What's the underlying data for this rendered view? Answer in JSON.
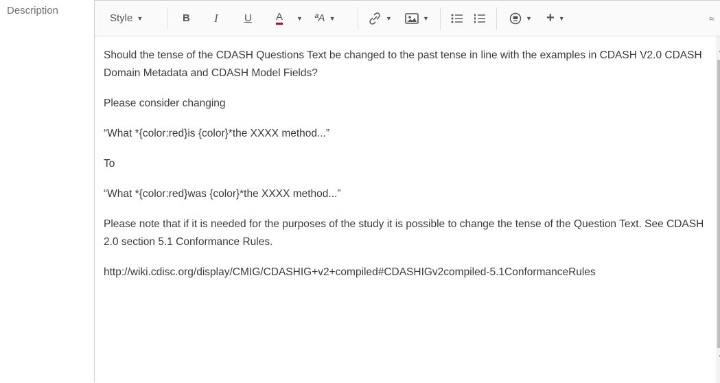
{
  "field": {
    "label": "Description"
  },
  "toolbar": {
    "style_label": "Style",
    "bold": "B",
    "italic": "I",
    "underline": "U",
    "text_color": "A",
    "more_formatting": "ªA",
    "link_icon": "link-icon",
    "image_icon": "image-icon",
    "bullet_list_icon": "bullet-list-icon",
    "numbered_list_icon": "numbered-list-icon",
    "emoticon_icon": "emoticon-icon",
    "insert_label": "+",
    "collapse_icon": "collapse-icon",
    "text_color_hex": "#d0021b"
  },
  "content": {
    "paragraphs": [
      "Should the tense of the CDASH Questions Text be changed to the past tense in line with the examples in CDASH V2.0 CDASH Domain Metadata and CDASH Model Fields?",
      "Please consider changing",
      "“What *{color:red}is {color}*the XXXX method...”",
      "To",
      "“What *{color:red}was {color}*the XXXX method...”",
      "Please note that if it is needed for the purposes of the study it is possible to change the tense of the Question Text. See CDASH 2.0 section 5.1 Conformance Rules.",
      "http://wiki.cdisc.org/display/CMIG/CDASHIG+v2+compiled#CDASHIGv2compiled-5.1ConformanceRules"
    ]
  }
}
